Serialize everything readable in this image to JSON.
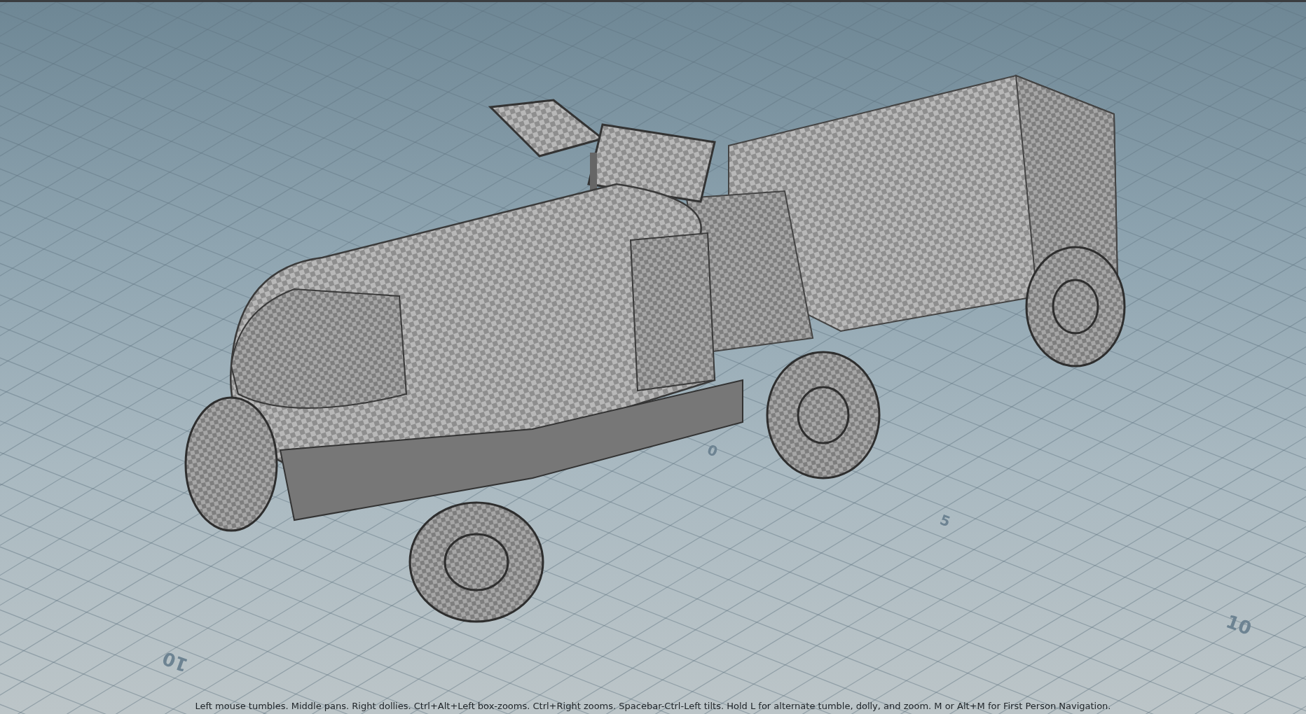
{
  "viewport": {
    "grid_labels": [
      {
        "text": "0",
        "kind": "near"
      },
      {
        "text": "5",
        "kind": "near"
      },
      {
        "text": "10",
        "kind": "far"
      },
      {
        "text": "10",
        "kind": "flipped"
      }
    ],
    "hint": "Left mouse tumbles. Middle pans. Right dollies. Ctrl+Alt+Left box-zooms. Ctrl+Right zooms. Spacebar-Ctrl-Left tilts. Hold L for alternate tumble, dolly, and zoom. M or Alt+M for First Person Navigation."
  }
}
